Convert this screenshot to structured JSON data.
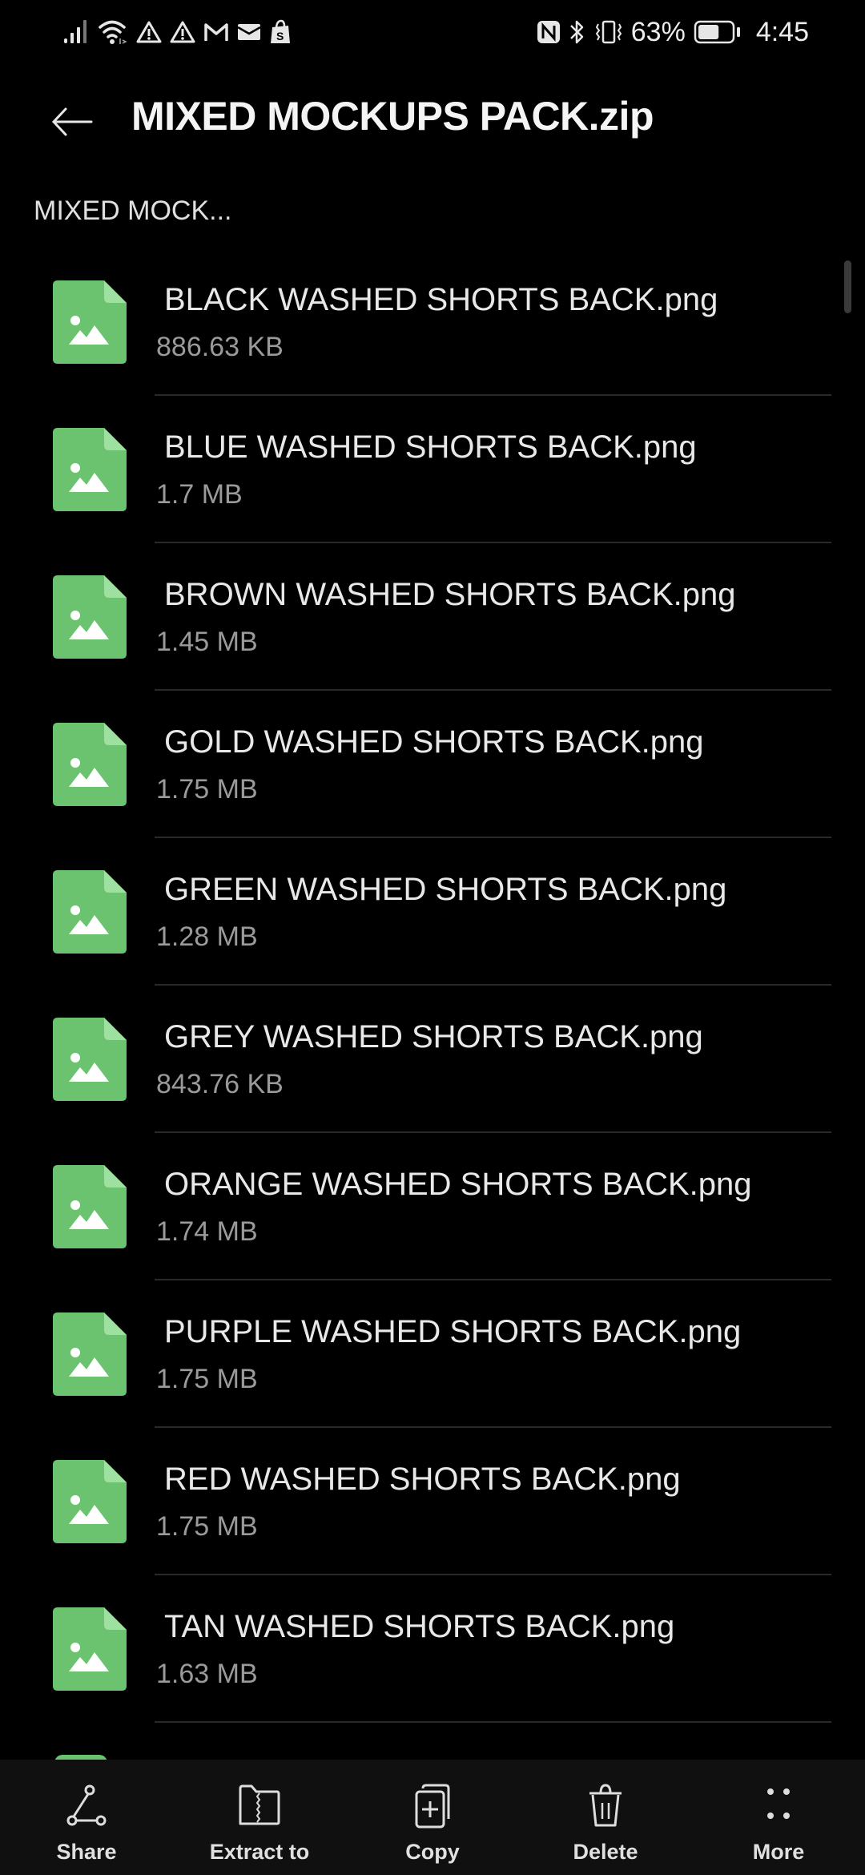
{
  "status_bar": {
    "icons_left": [
      "signal-icon",
      "wifi-icon",
      "warning-icon",
      "warning-icon",
      "gmail-icon",
      "mail-icon",
      "shopify-icon"
    ],
    "icons_right": [
      "nfc-icon",
      "bluetooth-icon",
      "vibrate-icon"
    ],
    "battery_percent": "63%",
    "battery_level": 0.63,
    "time": "4:45"
  },
  "header": {
    "back_icon": "arrow-left-icon",
    "title": "MIXED MOCKUPS PACK.zip"
  },
  "breadcrumb": "MIXED MOCK...",
  "files": [
    {
      "name": "BLACK WASHED SHORTS BACK.png",
      "size": "886.63 KB"
    },
    {
      "name": "BLUE WASHED SHORTS BACK.png",
      "size": "1.7 MB"
    },
    {
      "name": "BROWN WASHED SHORTS BACK.png",
      "size": "1.45 MB"
    },
    {
      "name": "GOLD WASHED SHORTS BACK.png",
      "size": "1.75 MB"
    },
    {
      "name": "GREEN WASHED SHORTS BACK.png",
      "size": "1.28 MB"
    },
    {
      "name": "GREY WASHED SHORTS BACK.png",
      "size": "843.76 KB"
    },
    {
      "name": "ORANGE WASHED SHORTS BACK.png",
      "size": "1.74 MB"
    },
    {
      "name": "PURPLE WASHED SHORTS BACK.png",
      "size": "1.75 MB"
    },
    {
      "name": "RED WASHED SHORTS BACK.png",
      "size": "1.75 MB"
    },
    {
      "name": "TAN WASHED SHORTS BACK.png",
      "size": "1.63 MB"
    }
  ],
  "bottom_bar": {
    "items": [
      {
        "label": "Share",
        "icon": "share-icon"
      },
      {
        "label": "Extract to",
        "icon": "extract-folder-icon"
      },
      {
        "label": "Copy",
        "icon": "copy-icon"
      },
      {
        "label": "Delete",
        "icon": "trash-icon"
      },
      {
        "label": "More",
        "icon": "more-dots-icon"
      }
    ]
  },
  "colors": {
    "background": "#000000",
    "image_file_icon": "#6cc36f",
    "image_file_fold": "#9de09f",
    "bottom_bar": "#101010",
    "secondary_text": "#9a9a9a"
  }
}
